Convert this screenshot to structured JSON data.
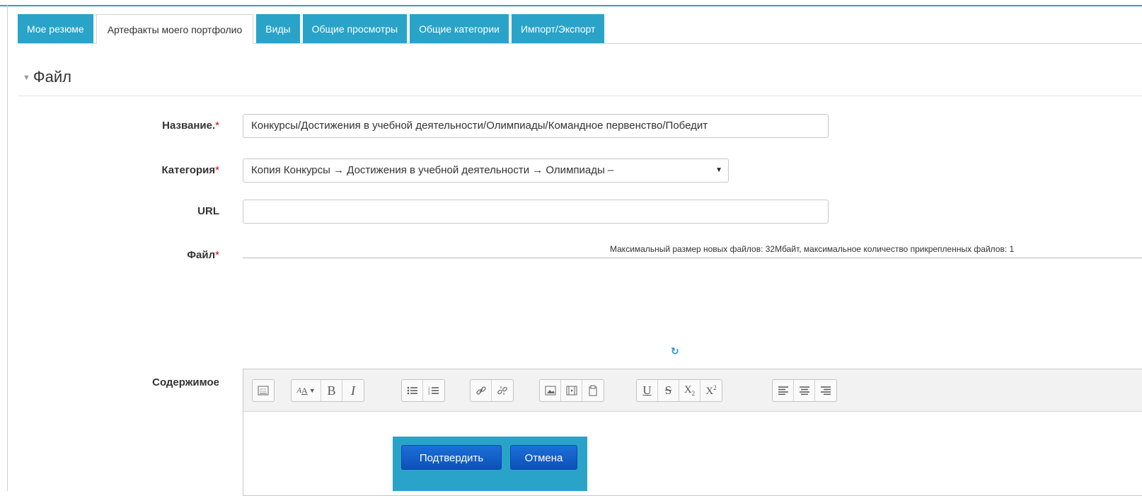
{
  "tabs": [
    {
      "label": "Мое резюме"
    },
    {
      "label": "Артефакты моего портфолио"
    },
    {
      "label": "Виды"
    },
    {
      "label": "Общие просмотры"
    },
    {
      "label": "Общие категории"
    },
    {
      "label": "Импорт/Экспорт"
    }
  ],
  "active_tab": "Артефакты моего портфолио",
  "section": {
    "title": "Файл"
  },
  "form": {
    "name_label": "Название.",
    "name_value": "Конкурсы/Достижения в учебной деятельности/Олимпиады/Командное первенство/Победит",
    "category_label": "Категория",
    "category_value": "Копия Конкурсы → Достижения в учебной деятельности → Олимпиады –",
    "url_label": "URL",
    "url_value": "",
    "file_label": "Файл",
    "file_info": "Максимальный размер новых файлов: 32Мбайт, максимальное количество прикрепленных файлов: 1",
    "content_label": "Содержимое",
    "required_mark": "*"
  },
  "buttons": {
    "confirm": "Подтвердить",
    "cancel": "Отмена"
  },
  "colors": {
    "accent": "#2aa3c9",
    "button": "#0b51b8",
    "required": "#d0021b"
  },
  "toolbar_icons": [
    "show-more-icon",
    "font-style-icon",
    "bold-icon",
    "italic-icon",
    "unordered-list-icon",
    "ordered-list-icon",
    "link-icon",
    "unlink-icon",
    "image-icon",
    "media-icon",
    "manage-files-icon",
    "underline-icon",
    "strikethrough-icon",
    "subscript-icon",
    "superscript-icon",
    "align-left-icon",
    "align-center-icon",
    "align-right-icon"
  ]
}
